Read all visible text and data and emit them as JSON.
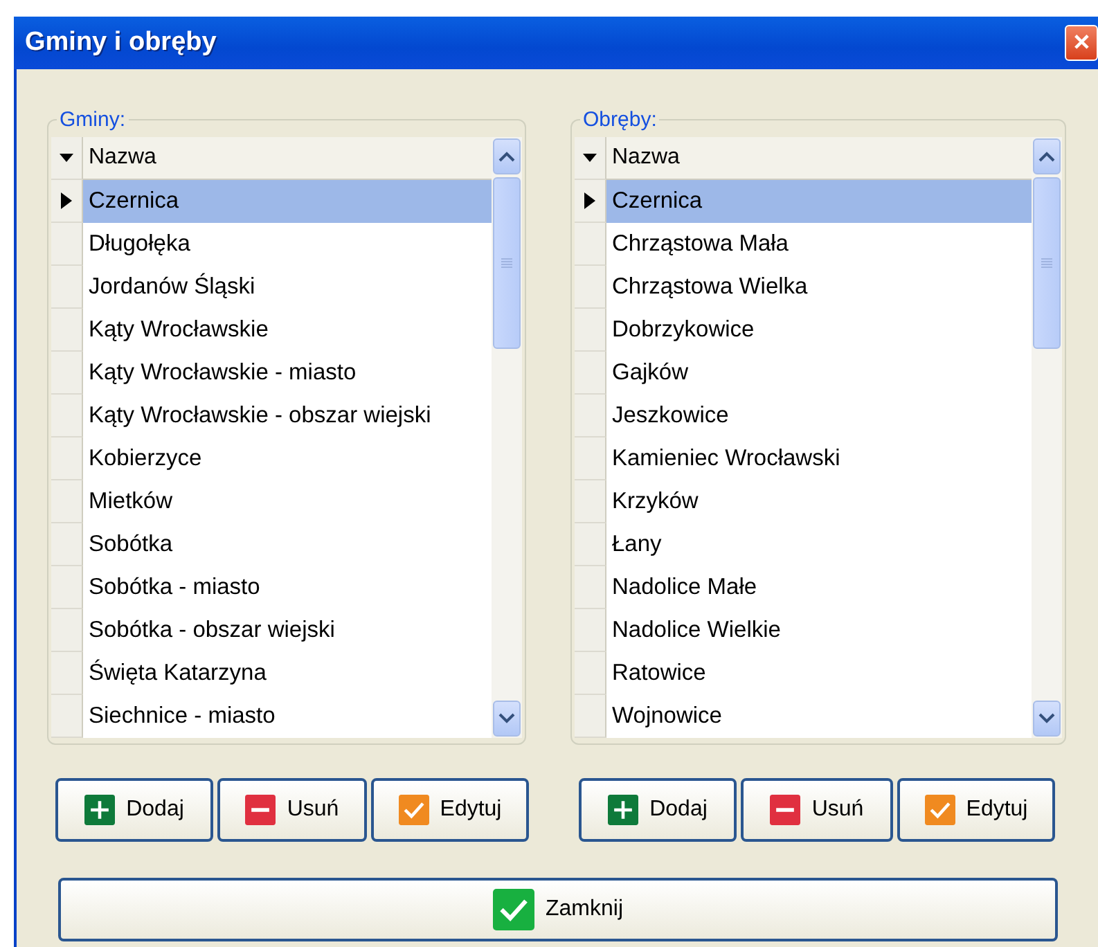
{
  "window": {
    "title": "Gminy i obręby",
    "close": "✕"
  },
  "panels": [
    {
      "legend": "Gminy:",
      "column": "Nazwa",
      "rows": [
        {
          "name": "Czernica",
          "selected": true
        },
        {
          "name": "Długołęka",
          "selected": false
        },
        {
          "name": "Jordanów Śląski",
          "selected": false
        },
        {
          "name": "Kąty Wrocławskie",
          "selected": false
        },
        {
          "name": "Kąty Wrocławskie - miasto",
          "selected": false
        },
        {
          "name": "Kąty Wrocławskie - obszar wiejski",
          "selected": false
        },
        {
          "name": "Kobierzyce",
          "selected": false
        },
        {
          "name": "Mietków",
          "selected": false
        },
        {
          "name": "Sobótka",
          "selected": false
        },
        {
          "name": "Sobótka - miasto",
          "selected": false
        },
        {
          "name": "Sobótka - obszar wiejski",
          "selected": false
        },
        {
          "name": "Święta Katarzyna",
          "selected": false
        },
        {
          "name": "Siechnice - miasto",
          "selected": false
        }
      ],
      "buttons": [
        {
          "kind": "add",
          "label": "Dodaj"
        },
        {
          "kind": "remove",
          "label": "Usuń"
        },
        {
          "kind": "edit",
          "label": "Edytuj"
        }
      ]
    },
    {
      "legend": "Obręby:",
      "column": "Nazwa",
      "rows": [
        {
          "name": "Czernica",
          "selected": true
        },
        {
          "name": "Chrząstowa Mała",
          "selected": false
        },
        {
          "name": "Chrząstowa Wielka",
          "selected": false
        },
        {
          "name": "Dobrzykowice",
          "selected": false
        },
        {
          "name": "Gajków",
          "selected": false
        },
        {
          "name": "Jeszkowice",
          "selected": false
        },
        {
          "name": "Kamieniec Wrocławski",
          "selected": false
        },
        {
          "name": "Krzyków",
          "selected": false
        },
        {
          "name": "Łany",
          "selected": false
        },
        {
          "name": "Nadolice Małe",
          "selected": false
        },
        {
          "name": "Nadolice Wielkie",
          "selected": false
        },
        {
          "name": "Ratowice",
          "selected": false
        },
        {
          "name": "Wojnowice",
          "selected": false
        }
      ],
      "buttons": [
        {
          "kind": "add",
          "label": "Dodaj"
        },
        {
          "kind": "remove",
          "label": "Usuń"
        },
        {
          "kind": "edit",
          "label": "Edytuj"
        }
      ]
    }
  ],
  "close_button": {
    "kind": "ok",
    "label": "Zamknij"
  }
}
